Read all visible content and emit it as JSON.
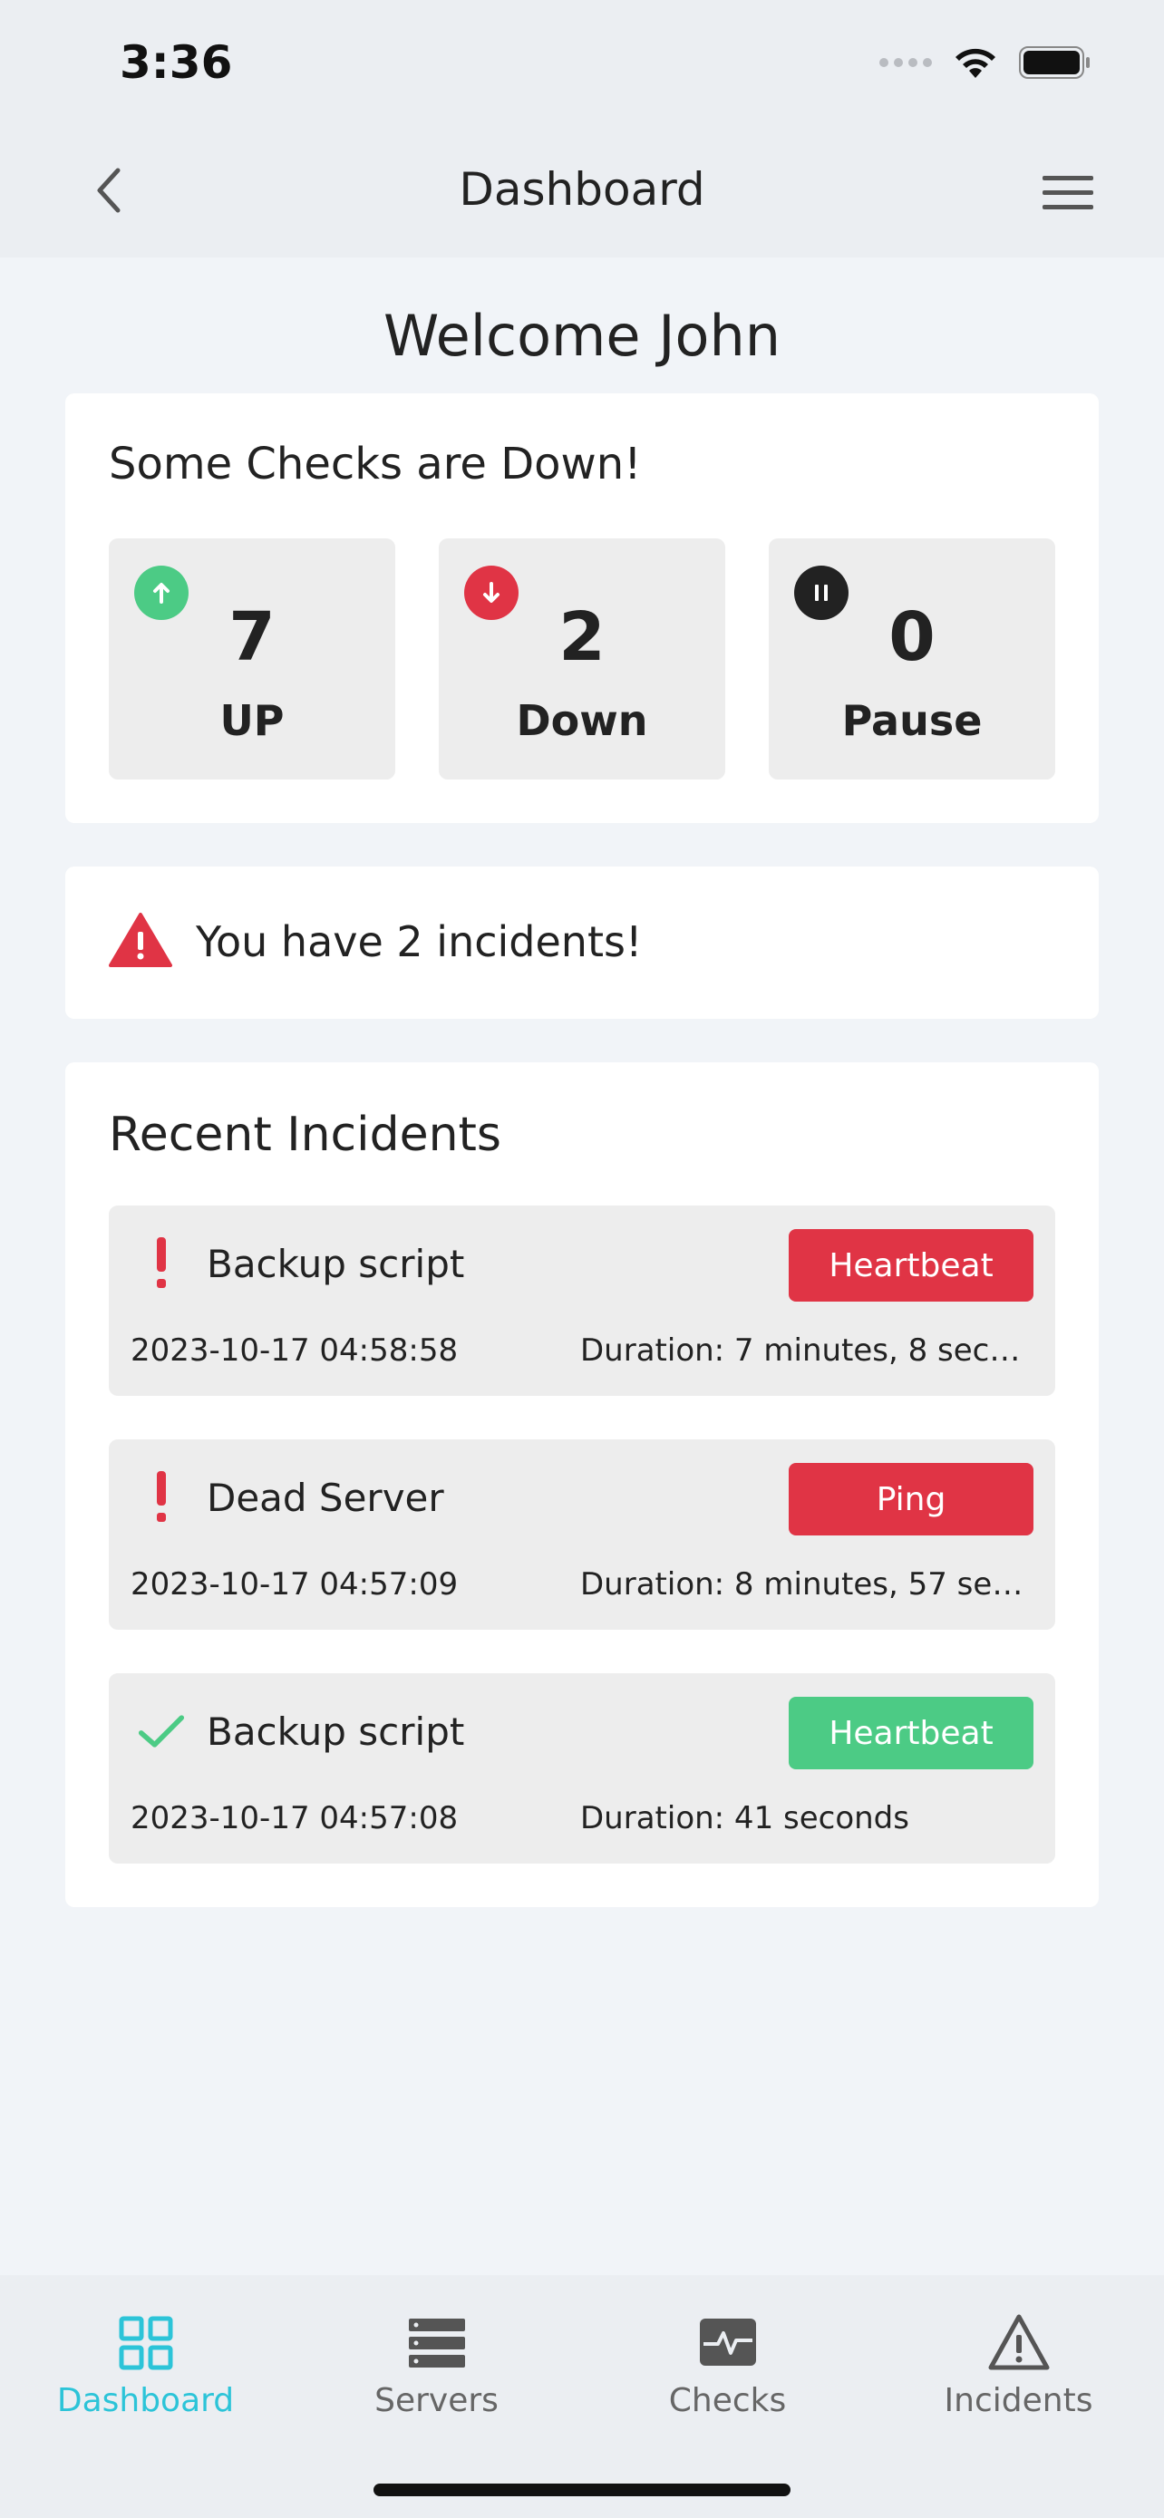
{
  "status_bar": {
    "time": "3:36"
  },
  "header": {
    "title": "Dashboard"
  },
  "welcome": "Welcome John",
  "summary": {
    "title": "Some Checks are Down!",
    "stats": [
      {
        "value": "7",
        "label": "UP",
        "color": "#4ccb85",
        "icon": "arrow-up-icon"
      },
      {
        "value": "2",
        "label": "Down",
        "color": "#e03445",
        "icon": "arrow-down-icon"
      },
      {
        "value": "0",
        "label": "Pause",
        "color": "#222222",
        "icon": "pause-icon"
      }
    ]
  },
  "alert": {
    "text": "You have 2 incidents!",
    "color": "#e03445"
  },
  "recent": {
    "title": "Recent Incidents",
    "items": [
      {
        "name": "Backup script",
        "type": "Heartbeat",
        "date": "2023-10-17 04:58:58",
        "duration": "Duration: 7 minutes, 8 secon...",
        "status": "down",
        "badge_color": "#e03445"
      },
      {
        "name": "Dead Server",
        "type": "Ping",
        "date": "2023-10-17 04:57:09",
        "duration": "Duration: 8 minutes, 57 seco...",
        "status": "down",
        "badge_color": "#e03445"
      },
      {
        "name": "Backup script",
        "type": "Heartbeat",
        "date": "2023-10-17 04:57:08",
        "duration": "Duration: 41 seconds",
        "status": "resolved",
        "badge_color": "#4ccb85"
      }
    ]
  },
  "tabs": [
    {
      "label": "Dashboard",
      "icon": "grid-icon",
      "active": true
    },
    {
      "label": "Servers",
      "icon": "server-icon",
      "active": false
    },
    {
      "label": "Checks",
      "icon": "pulse-icon",
      "active": false
    },
    {
      "label": "Incidents",
      "icon": "warning-icon",
      "active": false
    }
  ],
  "colors": {
    "accent": "#2cc4d8",
    "up": "#4ccb85",
    "down": "#e03445"
  }
}
